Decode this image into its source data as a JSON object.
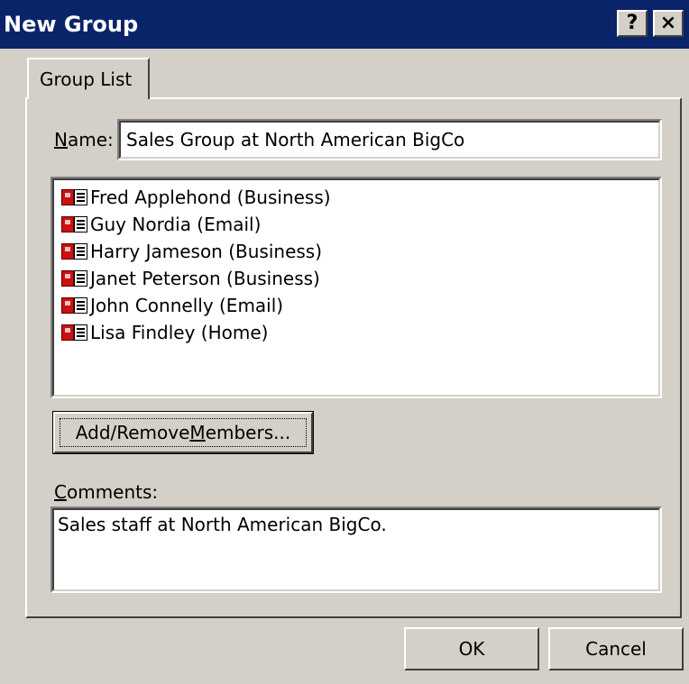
{
  "window": {
    "title": "New Group",
    "help_label": "?",
    "close_label": "×"
  },
  "tabs": [
    {
      "label": "Group List"
    }
  ],
  "name": {
    "label_mnemonic": "N",
    "label_rest": "ame:",
    "value": "Sales Group at North American BigCo"
  },
  "members": [
    {
      "label": "Fred Applehond (Business)",
      "icon": "contact-card-icon"
    },
    {
      "label": "Guy Nordia (Email)",
      "icon": "contact-card-icon"
    },
    {
      "label": "Harry Jameson (Business)",
      "icon": "contact-card-icon"
    },
    {
      "label": "Janet Peterson (Business)",
      "icon": "contact-card-icon"
    },
    {
      "label": "John Connelly (Email)",
      "icon": "contact-card-icon"
    },
    {
      "label": "Lisa Findley (Home)",
      "icon": "contact-card-icon"
    }
  ],
  "add_remove": {
    "label_before": "Add/Remove ",
    "label_mnemonic": "M",
    "label_after": "embers..."
  },
  "comments": {
    "label_mnemonic": "C",
    "label_rest": "omments:",
    "value": "Sales staff at North American BigCo."
  },
  "buttons": {
    "ok": "OK",
    "cancel": "Cancel"
  },
  "colors": {
    "titlebar": "#0a246a",
    "face": "#d4d0c8",
    "contact_icon_red": "#cc1111"
  }
}
